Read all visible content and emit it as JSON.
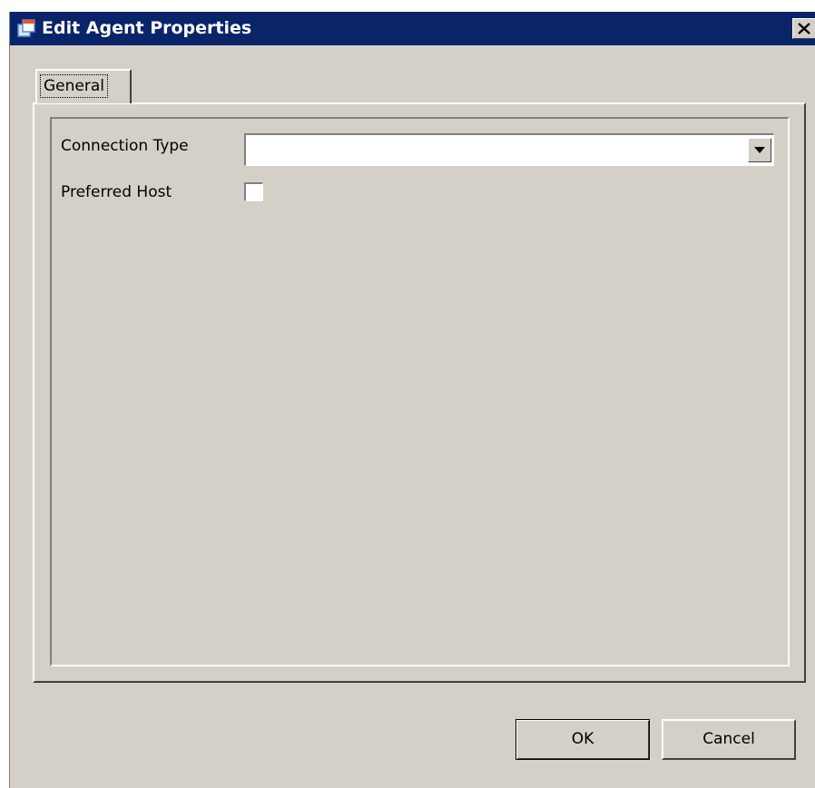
{
  "window": {
    "title": "Edit Agent Properties",
    "title_icon": "app-window-icon",
    "close_icon": "close-icon",
    "titlebar_color": "#0a246a",
    "background_color": "#d4d0c8"
  },
  "tabs": [
    {
      "label": "General",
      "selected": true
    }
  ],
  "form": {
    "connection_type": {
      "label": "Connection Type",
      "value": "",
      "dropdown_icon": "chevron-down-icon"
    },
    "preferred_host": {
      "label": "Preferred Host",
      "checked": false
    }
  },
  "buttons": {
    "ok_label": "OK",
    "cancel_label": "Cancel"
  }
}
